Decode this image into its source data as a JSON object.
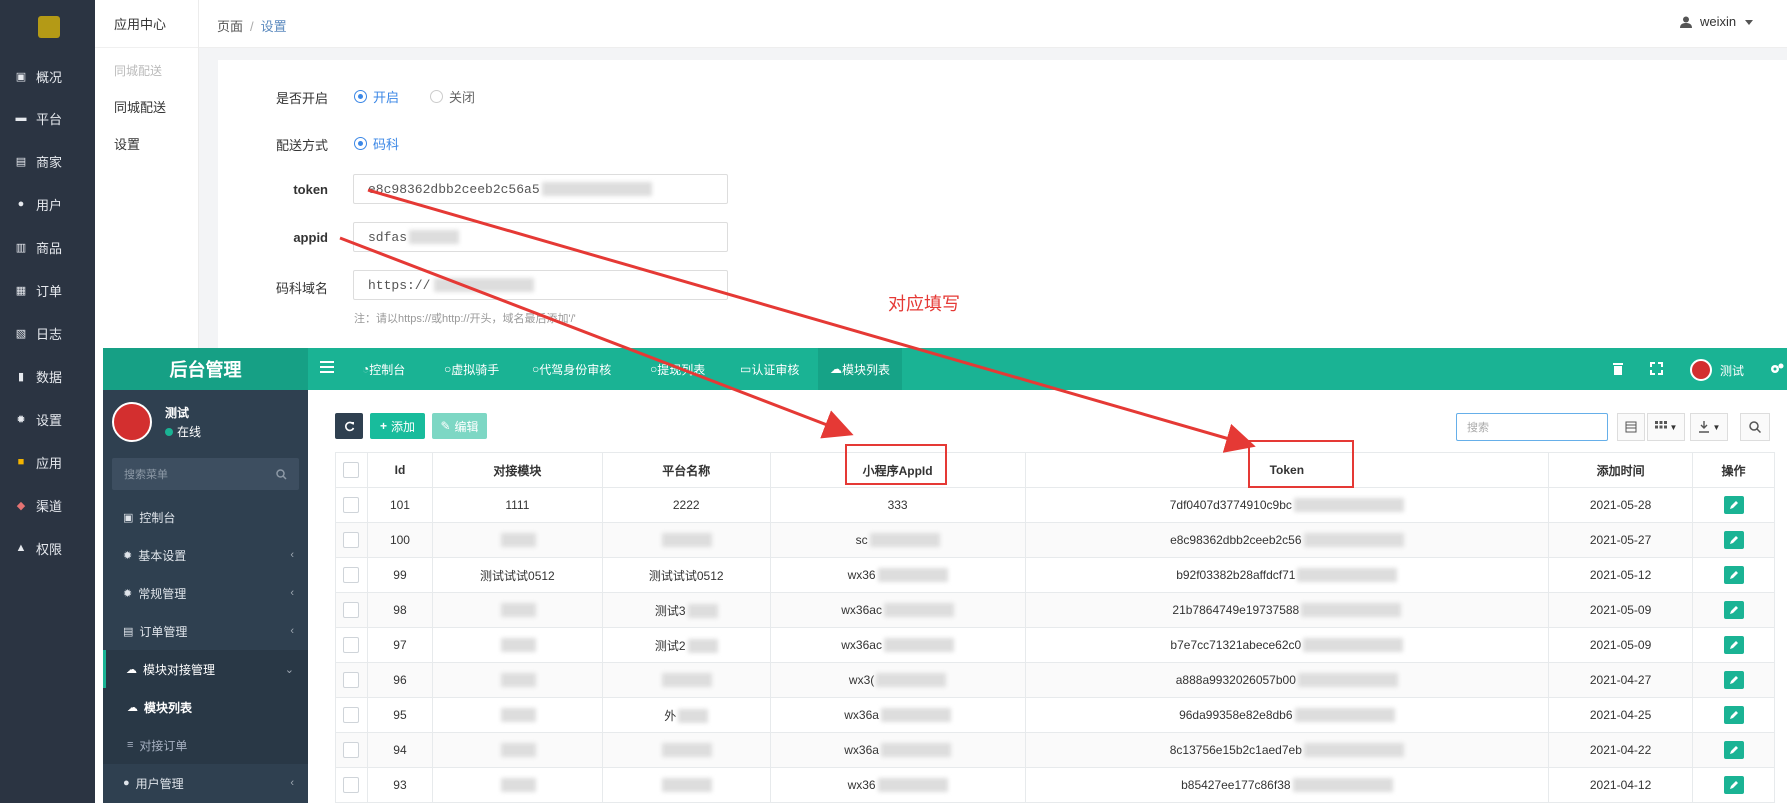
{
  "rail": {
    "items": [
      {
        "label": "概况",
        "icon": "dashboard-icon"
      },
      {
        "label": "平台",
        "icon": "monitor-icon"
      },
      {
        "label": "商家",
        "icon": "store-icon"
      },
      {
        "label": "用户",
        "icon": "user-icon"
      },
      {
        "label": "商品",
        "icon": "product-icon"
      },
      {
        "label": "订单",
        "icon": "order-icon"
      },
      {
        "label": "日志",
        "icon": "log-icon"
      },
      {
        "label": "数据",
        "icon": "chart-icon"
      },
      {
        "label": "设置",
        "icon": "gear-icon"
      },
      {
        "label": "应用",
        "icon": "apps-icon"
      },
      {
        "label": "渠道",
        "icon": "cube-icon"
      },
      {
        "label": "权限",
        "icon": "lock-icon"
      }
    ]
  },
  "sub": {
    "title": "应用中心",
    "group": "同城配送",
    "items": [
      "同城配送",
      "设置"
    ]
  },
  "header": {
    "crumb_root": "页面",
    "crumb_sep": "/",
    "crumb_current": "设置",
    "username": "weixin"
  },
  "settings": {
    "enable_label": "是否开启",
    "enable_on": "开启",
    "enable_off": "关闭",
    "method_label": "配送方式",
    "method_value": "码科",
    "token_label": "token",
    "token_value": "e8c98362dbb2ceeb2c56a5",
    "appid_label": "appid",
    "appid_value": "sdfas",
    "domain_label": "码科域名",
    "domain_value": "https://",
    "domain_hint": "注：请以https://或http://开头，域名最后添加'/'"
  },
  "annotation": {
    "text": "对应填写",
    "color": "#e53935"
  },
  "admin": {
    "brand": "后台管理",
    "nav": [
      "控制台",
      "虚拟骑手",
      "代驾身份审核",
      "提现列表",
      "认证审核",
      "模块列表"
    ],
    "nav_active": "模块列表",
    "user_label": "测试",
    "profile_name": "测试",
    "profile_status": "在线",
    "search_placeholder": "搜索菜单",
    "side": [
      {
        "label": "控制台",
        "icon": "dashboard-icon"
      },
      {
        "label": "基本设置",
        "icon": "gear-icon"
      },
      {
        "label": "常规管理",
        "icon": "cogs-icon"
      },
      {
        "label": "订单管理",
        "icon": "file-icon"
      },
      {
        "label": "模块对接管理",
        "icon": "cloud-icon"
      },
      {
        "label": "模块列表",
        "icon": "cloud-icon"
      },
      {
        "label": "对接订单",
        "icon": "list-icon"
      },
      {
        "label": "用户管理",
        "icon": "user-icon"
      }
    ],
    "toolbar": {
      "add": "添加",
      "edit": "编辑",
      "search_placeholder": "搜索"
    },
    "columns": [
      "Id",
      "对接模块",
      "平台名称",
      "小程序AppId",
      "Token",
      "添加时间",
      "操作"
    ],
    "rows": [
      {
        "id": "101",
        "module": "1111",
        "platform": "2222",
        "appid": "333",
        "token": "7df0407d3774910c9bc",
        "time": "2021-05-28"
      },
      {
        "id": "100",
        "module": "",
        "platform": "",
        "appid": "sc",
        "token": "e8c98362dbb2ceeb2c56",
        "time": "2021-05-27"
      },
      {
        "id": "99",
        "module": "测试试试0512",
        "platform": "测试试试0512",
        "appid": "wx36",
        "token": "b92f03382b28affdcf71",
        "time": "2021-05-12"
      },
      {
        "id": "98",
        "module": "",
        "platform": "测试3",
        "appid": "wx36ac",
        "token": "21b7864749e19737588",
        "time": "2021-05-09"
      },
      {
        "id": "97",
        "module": "",
        "platform": "测试2",
        "appid": "wx36ac",
        "token": "b7e7cc71321abece62c0",
        "time": "2021-05-09"
      },
      {
        "id": "96",
        "module": "",
        "platform": "",
        "appid": "wx3(",
        "token": "a888a9932026057b00",
        "time": "2021-04-27"
      },
      {
        "id": "95",
        "module": "",
        "platform": "外",
        "appid": "wx36a",
        "token": "96da99358e82e8db6",
        "time": "2021-04-25"
      },
      {
        "id": "94",
        "module": "",
        "platform": "",
        "appid": "wx36a",
        "token": "8c13756e15b2c1aed7eb",
        "time": "2021-04-22"
      },
      {
        "id": "93",
        "module": "",
        "platform": "",
        "appid": "wx36",
        "token": "b85427ee177c86f38",
        "time": "2021-04-12"
      }
    ]
  }
}
